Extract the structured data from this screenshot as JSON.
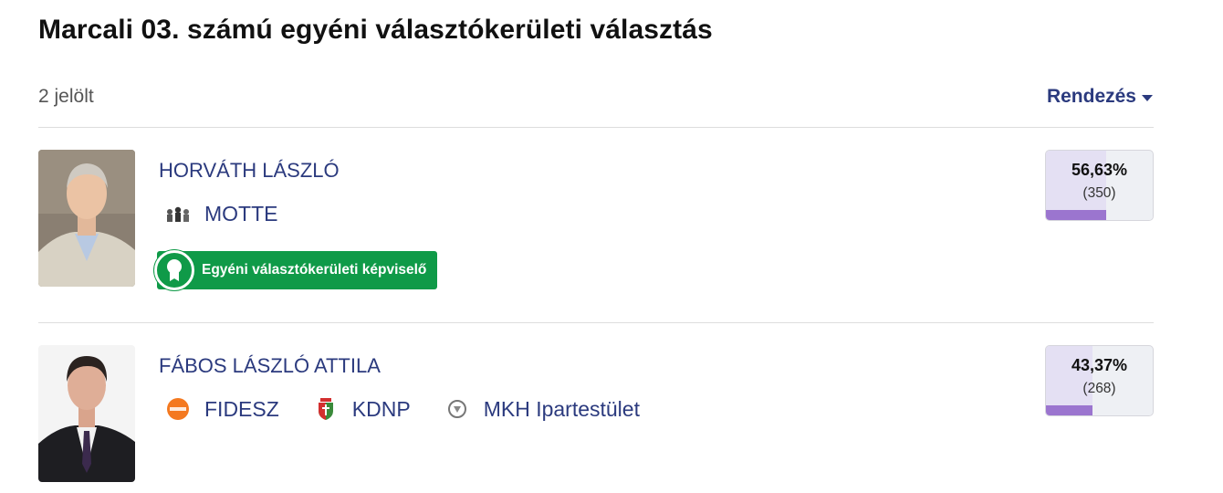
{
  "page_title": "Marcali 03. számú egyéni választókerületi választás",
  "candidate_count": "2 jelölt",
  "sort_label": "Rendezés",
  "candidates": [
    {
      "name": "HORVÁTH LÁSZLÓ",
      "parties": [
        {
          "label": "MOTTE",
          "icon": "motte-logo-icon"
        }
      ],
      "badge": "Egyéni választókerületi képviselő",
      "percent_text": "56,63%",
      "votes_text": "(350)",
      "percent_value": 56.63
    },
    {
      "name": "FÁBOS LÁSZLÓ ATTILA",
      "parties": [
        {
          "label": "FIDESZ",
          "icon": "fidesz-logo-icon"
        },
        {
          "label": "KDNP",
          "icon": "kdnp-logo-icon"
        },
        {
          "label": "MKH Ipartestület",
          "icon": "mkh-logo-icon"
        }
      ],
      "percent_text": "43,37%",
      "votes_text": "(268)",
      "percent_value": 43.37
    }
  ],
  "colors": {
    "accent": "#2b3a7e",
    "badge_green": "#0f9a48",
    "bar_purple": "#9b75cf",
    "bar_light": "#e4e0f3"
  }
}
